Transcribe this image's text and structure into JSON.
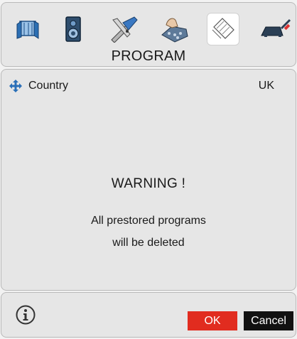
{
  "menu": {
    "title": "PROGRAM",
    "icons": [
      {
        "name": "picture-icon",
        "selected": false
      },
      {
        "name": "speaker-icon",
        "selected": false
      },
      {
        "name": "tools-icon",
        "selected": false
      },
      {
        "name": "hand-tuning-icon",
        "selected": false
      },
      {
        "name": "program-list-icon",
        "selected": true
      },
      {
        "name": "connection-icon",
        "selected": false
      }
    ]
  },
  "settings": {
    "country_label": "Country",
    "country_value": "UK",
    "arrows_icon": "four-way-arrows-icon"
  },
  "warning": {
    "title": "WARNING !",
    "line1": "All prestored programs",
    "line2": "will be deleted"
  },
  "footer": {
    "info_icon": "info-icon",
    "ok_label": "OK",
    "cancel_label": "Cancel"
  },
  "colors": {
    "ok": "#e12c1f",
    "cancel": "#111111",
    "arrows": "#2a6fb8"
  }
}
